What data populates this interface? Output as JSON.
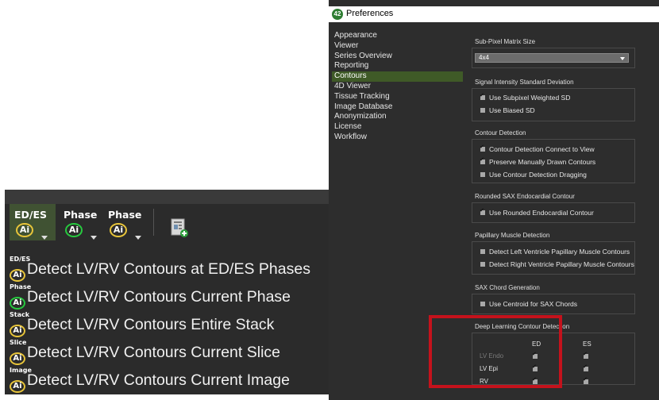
{
  "toolbar": {
    "buttons": [
      {
        "label": "ED/ES",
        "ai": "Ai"
      },
      {
        "label": "Phase",
        "ai": "Ai"
      },
      {
        "label": "Phase",
        "ai": "Ai"
      }
    ],
    "report_icon": "report-add-icon"
  },
  "menu": {
    "items": [
      {
        "tag": "ED/ES",
        "ai": "Ai",
        "label": "Detect LV/RV Contours at ED/ES Phases"
      },
      {
        "tag": "Phase",
        "ai": "Ai",
        "label": "Detect LV/RV Contours Current Phase"
      },
      {
        "tag": "Stack",
        "ai": "Ai",
        "label": "Detect LV/RV Contours Entire Stack"
      },
      {
        "tag": "Slice",
        "ai": "Ai",
        "label": "Detect LV/RV Contours Current Slice"
      },
      {
        "tag": "Image",
        "ai": "Ai",
        "label": "Detect LV/RV Contours Current Image"
      }
    ]
  },
  "prefs": {
    "app_icon": "42",
    "title": "Preferences",
    "sidebar": [
      {
        "label": "Appearance"
      },
      {
        "label": "Viewer"
      },
      {
        "label": "Series Overview"
      },
      {
        "label": "Reporting"
      },
      {
        "label": "Contours",
        "active": true
      },
      {
        "label": "4D Viewer"
      },
      {
        "label": "Tissue Tracking"
      },
      {
        "label": "Image Database"
      },
      {
        "label": "Anonymization"
      },
      {
        "label": "License"
      },
      {
        "label": "Workflow"
      }
    ],
    "subpixel": {
      "header": "Sub-Pixel Matrix Size",
      "value": "4x4"
    },
    "signal": {
      "header": "Signal Intensity Standard Deviation",
      "options": [
        {
          "label": "Use Subpixel Weighted SD",
          "checked": true
        },
        {
          "label": "Use Biased SD",
          "checked": false
        }
      ]
    },
    "contour_detection": {
      "header": "Contour Detection",
      "options": [
        {
          "label": "Contour Detection Connect to View",
          "checked": true
        },
        {
          "label": "Preserve Manually Drawn Contours",
          "checked": true
        },
        {
          "label": "Use Contour Detection Dragging",
          "checked": false
        }
      ]
    },
    "rounded": {
      "header": "Rounded SAX Endocardial Contour",
      "options": [
        {
          "label": "Use Rounded Endocardial Contour",
          "checked": true
        }
      ]
    },
    "papillary": {
      "header": "Papillary Muscle Detection",
      "options": [
        {
          "label": "Detect Left Ventricle Papillary Muscle Contours",
          "checked": false
        },
        {
          "label": "Detect Right Ventricle Papillary Muscle Contours",
          "checked": false
        }
      ]
    },
    "sax_chord": {
      "header": "SAX Chord Generation",
      "options": [
        {
          "label": "Use Centroid for SAX Chords",
          "checked": false
        }
      ]
    },
    "deep_learning": {
      "header": "Deep Learning Contour Detection",
      "columns": [
        "ED",
        "ES"
      ],
      "rows": [
        {
          "label": "LV Endo",
          "disabled": true,
          "ed": true,
          "es": true
        },
        {
          "label": "LV Epi",
          "disabled": false,
          "ed": true,
          "es": true
        },
        {
          "label": "RV",
          "disabled": false,
          "ed": true,
          "es": true
        }
      ]
    }
  }
}
